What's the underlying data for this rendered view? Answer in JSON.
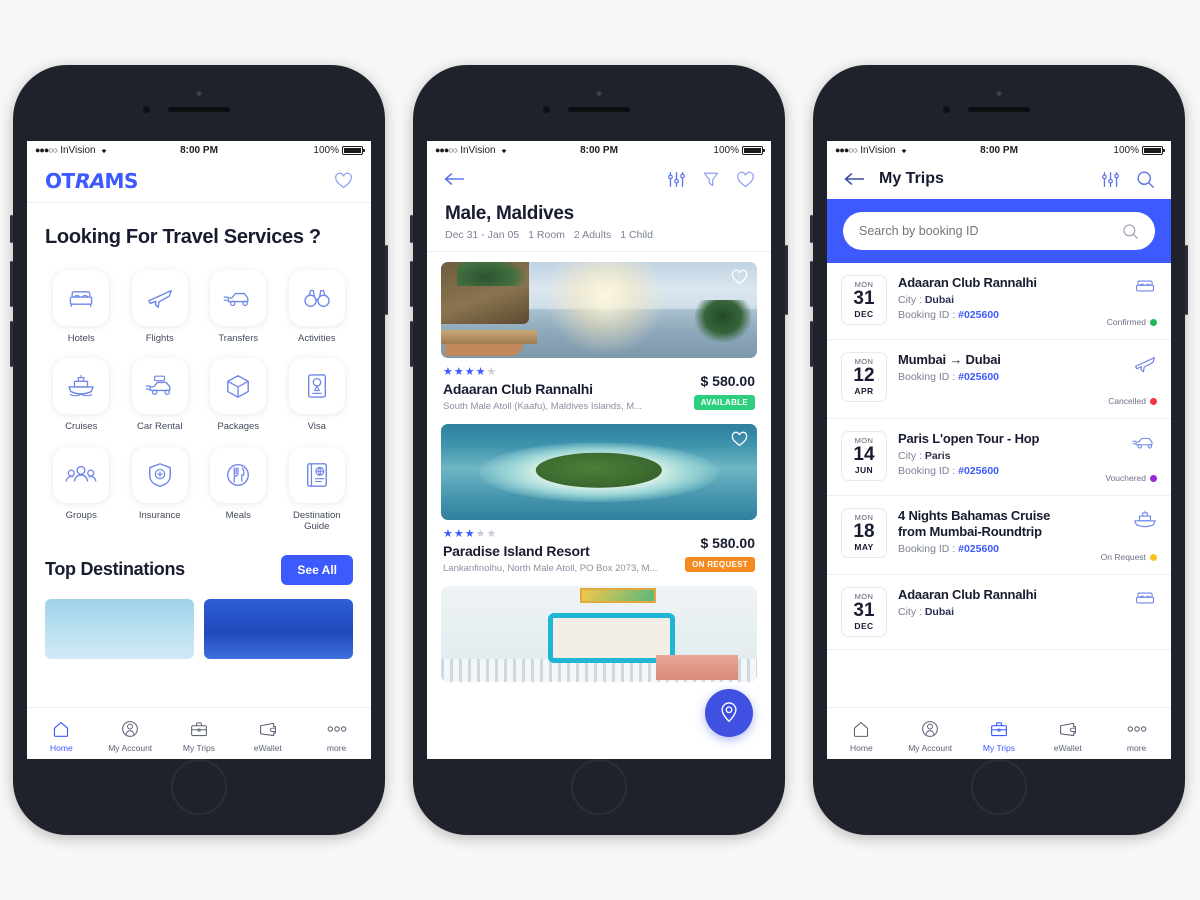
{
  "status_bar": {
    "carrier": "InVision",
    "signal_dots": "●●●○○",
    "time": "8:00 PM",
    "battery": "100%"
  },
  "colors": {
    "brand_blue": "#3d5afe",
    "navy": "#181c30",
    "green": "#2bcf7e",
    "orange": "#f58a1f",
    "red": "#f4353f",
    "purple": "#9b26d6",
    "yellow": "#f6c324"
  },
  "phone1": {
    "logo": "OTRAMS",
    "favorite_icon": "heart-icon",
    "title": "Looking For Travel Services ?",
    "services": [
      {
        "label": "Hotels",
        "icon": "bed-icon"
      },
      {
        "label": "Flights",
        "icon": "airplane-icon"
      },
      {
        "label": "Transfers",
        "icon": "transfer-car-icon"
      },
      {
        "label": "Activities",
        "icon": "binoculars-icon"
      },
      {
        "label": "Cruises",
        "icon": "ship-icon"
      },
      {
        "label": "Car Rental",
        "icon": "taxi-icon"
      },
      {
        "label": "Packages",
        "icon": "box-icon"
      },
      {
        "label": "Visa",
        "icon": "passport-icon"
      },
      {
        "label": "Groups",
        "icon": "people-icon"
      },
      {
        "label": "Insurance",
        "icon": "shield-plus-icon"
      },
      {
        "label": "Meals",
        "icon": "cutlery-icon"
      },
      {
        "label": "Destination Guide",
        "icon": "guidebook-icon"
      }
    ],
    "top_destinations": {
      "heading": "Top Destinations",
      "see_all": "See All"
    }
  },
  "phone2": {
    "back_icon": "arrow-left-icon",
    "icons": [
      "sliders-icon",
      "funnel-filter-icon",
      "heart-icon"
    ],
    "title": "Male, Maldives",
    "subtitle": [
      "Dec 31 - Jan 05",
      "1 Room",
      "2 Adults",
      "1 Child"
    ],
    "hotels": [
      {
        "name": "Adaaran Club Rannalhi",
        "address": "South Male Atoll (Kaafu), Maldives Islands, M...",
        "rating": 4,
        "price": "$ 580.00",
        "badge": "AVAILABLE",
        "badge_type": "available",
        "image": "resort-sunset-pool-photo"
      },
      {
        "name": "Paradise Island Resort",
        "address": "Lankanfinolhu, North Male Atoll, PO Box 2073, M...",
        "rating": 3,
        "price": "$ 580.00",
        "badge": "ON REQUEST",
        "badge_type": "onrequest",
        "image": "aerial-island-photo"
      },
      {
        "image": "hotel-room-interior-photo"
      }
    ],
    "map_fab_icon": "map-pin-icon"
  },
  "phone3": {
    "back_icon": "arrow-left-icon",
    "title": "My Trips",
    "icons": [
      "sliders-icon",
      "search-icon"
    ],
    "search_placeholder": "Search by booking ID",
    "trips": [
      {
        "weekday": "MON",
        "day": "31",
        "month": "DEC",
        "name": "Adaaran Club Rannalhi",
        "city_label": "City :",
        "city": "Dubai",
        "booking_label": "Booking ID :",
        "booking_id": "#025600",
        "status": "Confirmed",
        "status_color": "#1db954",
        "icon": "bed-icon"
      },
      {
        "weekday": "MON",
        "day": "12",
        "month": "APR",
        "name": "Mumbai  →  Dubai",
        "city_label": "",
        "city": "",
        "booking_label": "Booking ID :",
        "booking_id": "#025600",
        "status": "Cancelled",
        "status_color": "#f4353f",
        "icon": "airplane-icon"
      },
      {
        "weekday": "MON",
        "day": "14",
        "month": "JUN",
        "name": "Paris L'open Tour - Hop",
        "city_label": "City :",
        "city": "Paris",
        "booking_label": "Booking ID :",
        "booking_id": "#025600",
        "status": "Vouchered",
        "status_color": "#9b26d6",
        "icon": "transfer-car-icon"
      },
      {
        "weekday": "MON",
        "day": "18",
        "month": "MAY",
        "name": "4 Nights Bahamas Cruise from Mumbai-Roundtrip",
        "city_label": "",
        "city": "",
        "booking_label": "Booking ID :",
        "booking_id": "#025600",
        "status": "On Request",
        "status_color": "#f6c324",
        "icon": "ship-icon"
      },
      {
        "weekday": "MON",
        "day": "31",
        "month": "DEC",
        "name": "Adaaran Club Rannalhi",
        "city_label": "City :",
        "city": "Dubai",
        "booking_label": "",
        "booking_id": "",
        "status": "",
        "status_color": "#1db954",
        "icon": "bed-icon"
      }
    ]
  },
  "bottom_nav": [
    {
      "label": "Home",
      "icon": "home-icon"
    },
    {
      "label": "My Account",
      "icon": "user-circle-icon"
    },
    {
      "label": "My Trips",
      "icon": "briefcase-icon"
    },
    {
      "label": "eWallet",
      "icon": "wallet-icon"
    },
    {
      "label": "more",
      "icon": "ellipsis-icon"
    }
  ]
}
